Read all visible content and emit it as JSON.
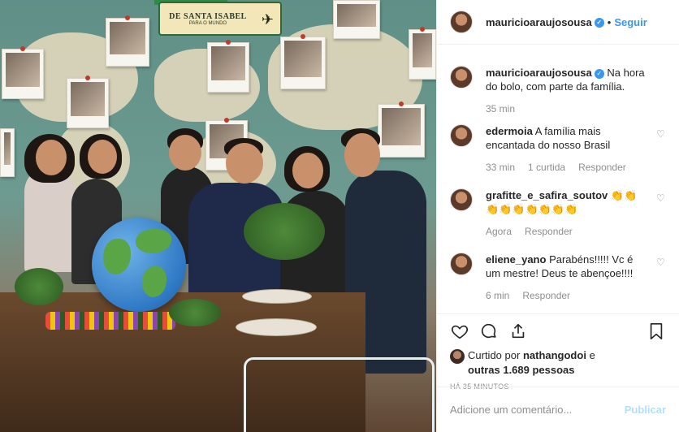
{
  "post": {
    "username": "mauricioaraujosousa",
    "follow_label": "Seguir",
    "separator": "•",
    "verified_glyph": "✓"
  },
  "photo": {
    "sign_text": "DE SANTA ISABEL",
    "sign_sub": "PARA O MUNDO"
  },
  "comments": [
    {
      "username": "mauricioaraujosousa",
      "text": "Na hora do bolo, com parte da família.",
      "time": "35 min",
      "likes": "",
      "reply": "",
      "is_caption": true,
      "avatar_icon": "profile-photo"
    },
    {
      "username": "edermoia",
      "text": "A família mais encantada do nosso Brasil",
      "time": "33 min",
      "likes": "1 curtida",
      "reply": "Responder",
      "avatar_icon": "profile-photo"
    },
    {
      "username": "grafitte_e_safira_soutov",
      "text": "👏👏👏👏👏👏👏👏👏",
      "time": "Agora",
      "likes": "",
      "reply": "Responder",
      "avatar_icon": "profile-photo"
    },
    {
      "username": "eliene_yano",
      "text": "Parabéns!!!!! Vc é um mestre! Deus te abençoe!!!!",
      "time": "6 min",
      "likes": "",
      "reply": "Responder",
      "avatar_icon": "profile-photo"
    }
  ],
  "actions": {
    "icons": [
      "heart-icon",
      "comment-icon",
      "share-icon",
      "bookmark-icon"
    ],
    "liked_by_prefix": "Curtido por",
    "liked_by_user": "nathangodoi",
    "liked_by_and": "e",
    "others": "outras 1.689 pessoas",
    "timestamp": "HÁ 35 MINUTOS"
  },
  "add_comment": {
    "placeholder": "Adicione um comentário...",
    "publish_label": "Publicar"
  },
  "colors": {
    "accent": "#3897f0",
    "publish_disabled": "#b2dffc",
    "muted": "#8e8e8e",
    "text": "#262626"
  }
}
